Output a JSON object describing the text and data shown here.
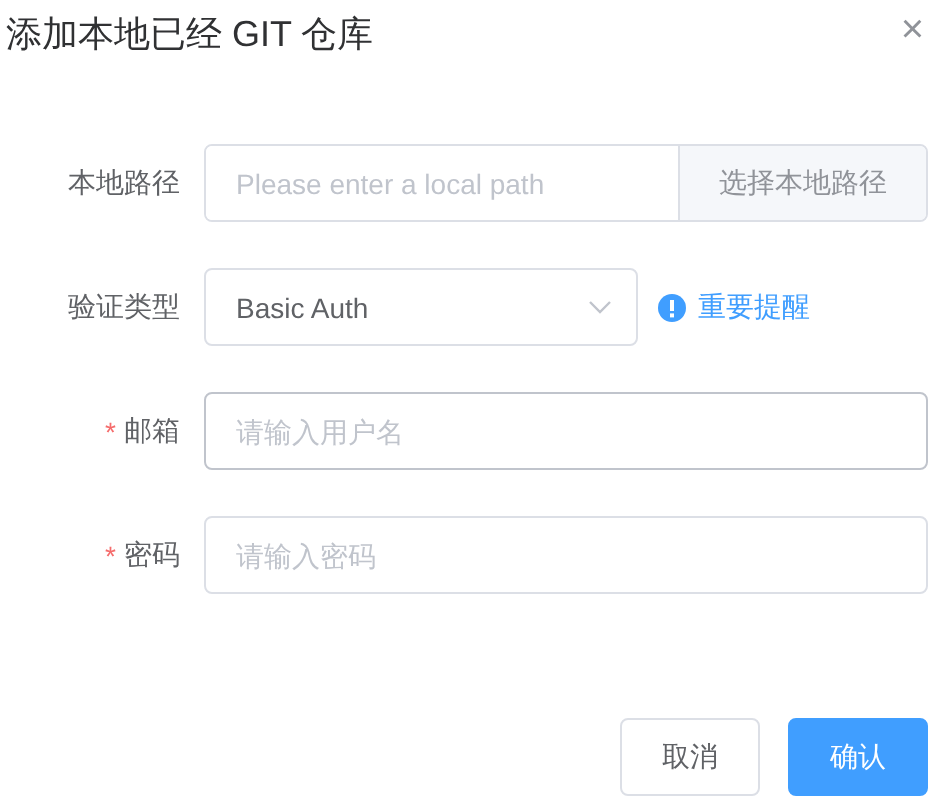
{
  "dialog": {
    "title": "添加本地已经 GIT 仓库",
    "close": "×"
  },
  "form": [
    {
      "kind": "path",
      "label": "本地路径",
      "placeholder": "Please enter a local path",
      "button": "选择本地路径"
    },
    {
      "kind": "select",
      "label": "验证类型",
      "value": "Basic Auth",
      "hint_link": "重要提醒"
    },
    {
      "kind": "input",
      "label": "邮箱",
      "required_mark": "*",
      "placeholder": "请输入用户名",
      "hovered": true
    },
    {
      "kind": "input",
      "label": "密码",
      "required_mark": "*",
      "placeholder": "请输入密码",
      "hovered": false
    }
  ],
  "buttons": [
    {
      "label": "取消",
      "primary": false
    },
    {
      "label": "确认",
      "primary": true
    }
  ]
}
